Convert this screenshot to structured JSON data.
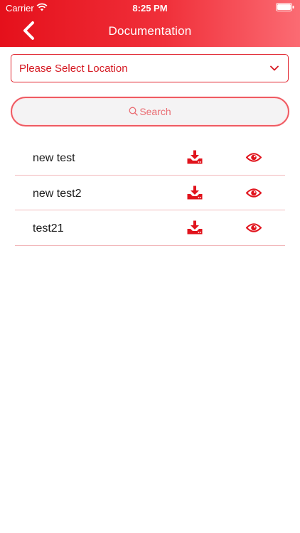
{
  "status_bar": {
    "carrier": "Carrier",
    "time": "8:25 PM",
    "icons": [
      "wifi-icon",
      "battery-icon"
    ]
  },
  "header": {
    "title": "Documentation",
    "back_icon": "chevron-left-icon"
  },
  "location_select": {
    "placeholder": "Please Select Location",
    "icon": "chevron-down-icon"
  },
  "search": {
    "placeholder": "Search",
    "icon": "search-icon"
  },
  "documents": [
    {
      "name": "new test",
      "actions": [
        "download-icon",
        "eye-icon"
      ]
    },
    {
      "name": "new test2",
      "actions": [
        "download-icon",
        "eye-icon"
      ]
    },
    {
      "name": "test21",
      "actions": [
        "download-icon",
        "eye-icon"
      ]
    }
  ],
  "colors": {
    "accent": "#e5101b",
    "accent_light": "#fb6b73",
    "divider": "#f2b8bb",
    "search_bg": "#f4f3f4"
  }
}
